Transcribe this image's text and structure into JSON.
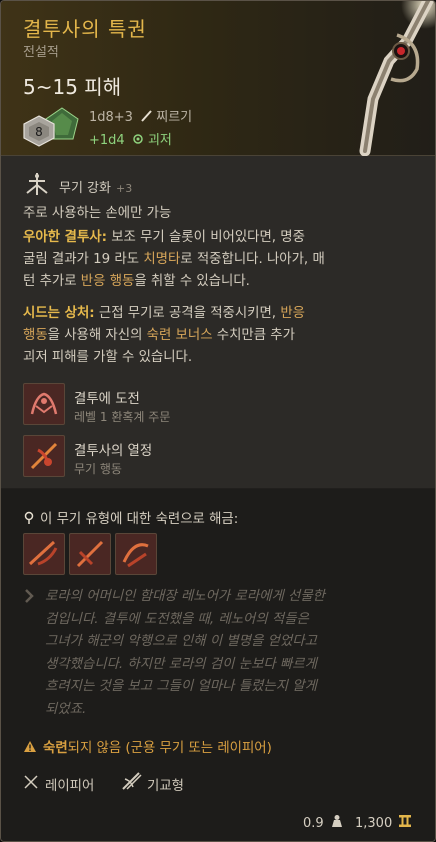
{
  "item": {
    "name": "결투사의 특권",
    "rarity": "전설적",
    "damage": "5~15 피해",
    "dice_label": "8",
    "dmg_line1": "1d8+3",
    "dmg_line1_type": "찌르기",
    "dmg_line2": "+1d4",
    "dmg_line2_type": "괴저"
  },
  "enhancement": {
    "label": "무기 강화",
    "bonus": "+3"
  },
  "text": {
    "mainhand": "주로 사용하는 손에만 가능",
    "grace_title": "우아한 결투사:",
    "grace_body1": " 보조 무기 슬롯이 비어있다면, 명중",
    "grace_body2a": "굴림 결과가 19 라도 ",
    "grace_crit": "치명타",
    "grace_body2b": "로 적중합니다. 나아가, 매",
    "grace_body3a": "턴 추가로 ",
    "grace_reaction": "반응 행동",
    "grace_body3b": "을 취할 수 있습니다.",
    "wound_title": "시드는 상처:",
    "wound_body1a": " 근접 무기로 공격을 적중시키면, ",
    "wound_reaction": "반응",
    "wound_body2a": "행동",
    "wound_body2b": "을 사용해 자신의 ",
    "wound_prof": "숙련 보너스",
    "wound_body2c": " 수치만큼 추가",
    "wound_body3": "괴저 피해를 가할 수 있습니다."
  },
  "actions": [
    {
      "title": "결투에 도전",
      "subtitle": "레벨 1 환혹계 주문"
    },
    {
      "title": "결투사의 열정",
      "subtitle": "무기 행동"
    }
  ],
  "unlock": {
    "label": "이 무기 유형에 대한 숙련으로 해금:"
  },
  "flavor": [
    "로라의 어머니인 함대장 레노어가 로라에게 선물한",
    "검입니다. 결투에 도전했을 때, 레노어의 적들은",
    "그녀가 해군의 악행으로 인해 이 별명을 얻었다고",
    "생각했습니다. 하지만 로라의 검이 눈보다 빠르게",
    "흐려지는 것을 보고 그들이 얼마나 틀렸는지 알게",
    "되었죠."
  ],
  "warning": {
    "part1": "숙련",
    "part2": "되지 않음 (군용 무기 또는 레이피어)"
  },
  "proficiency": {
    "type1": "레이피어",
    "type2": "기교형"
  },
  "footer": {
    "weight": "0.9",
    "price": "1,300"
  },
  "colors": {
    "title": "#e3b64b",
    "poison": "#8fd37e",
    "highlight": "#d7a65a",
    "warning": "#d9a041"
  }
}
